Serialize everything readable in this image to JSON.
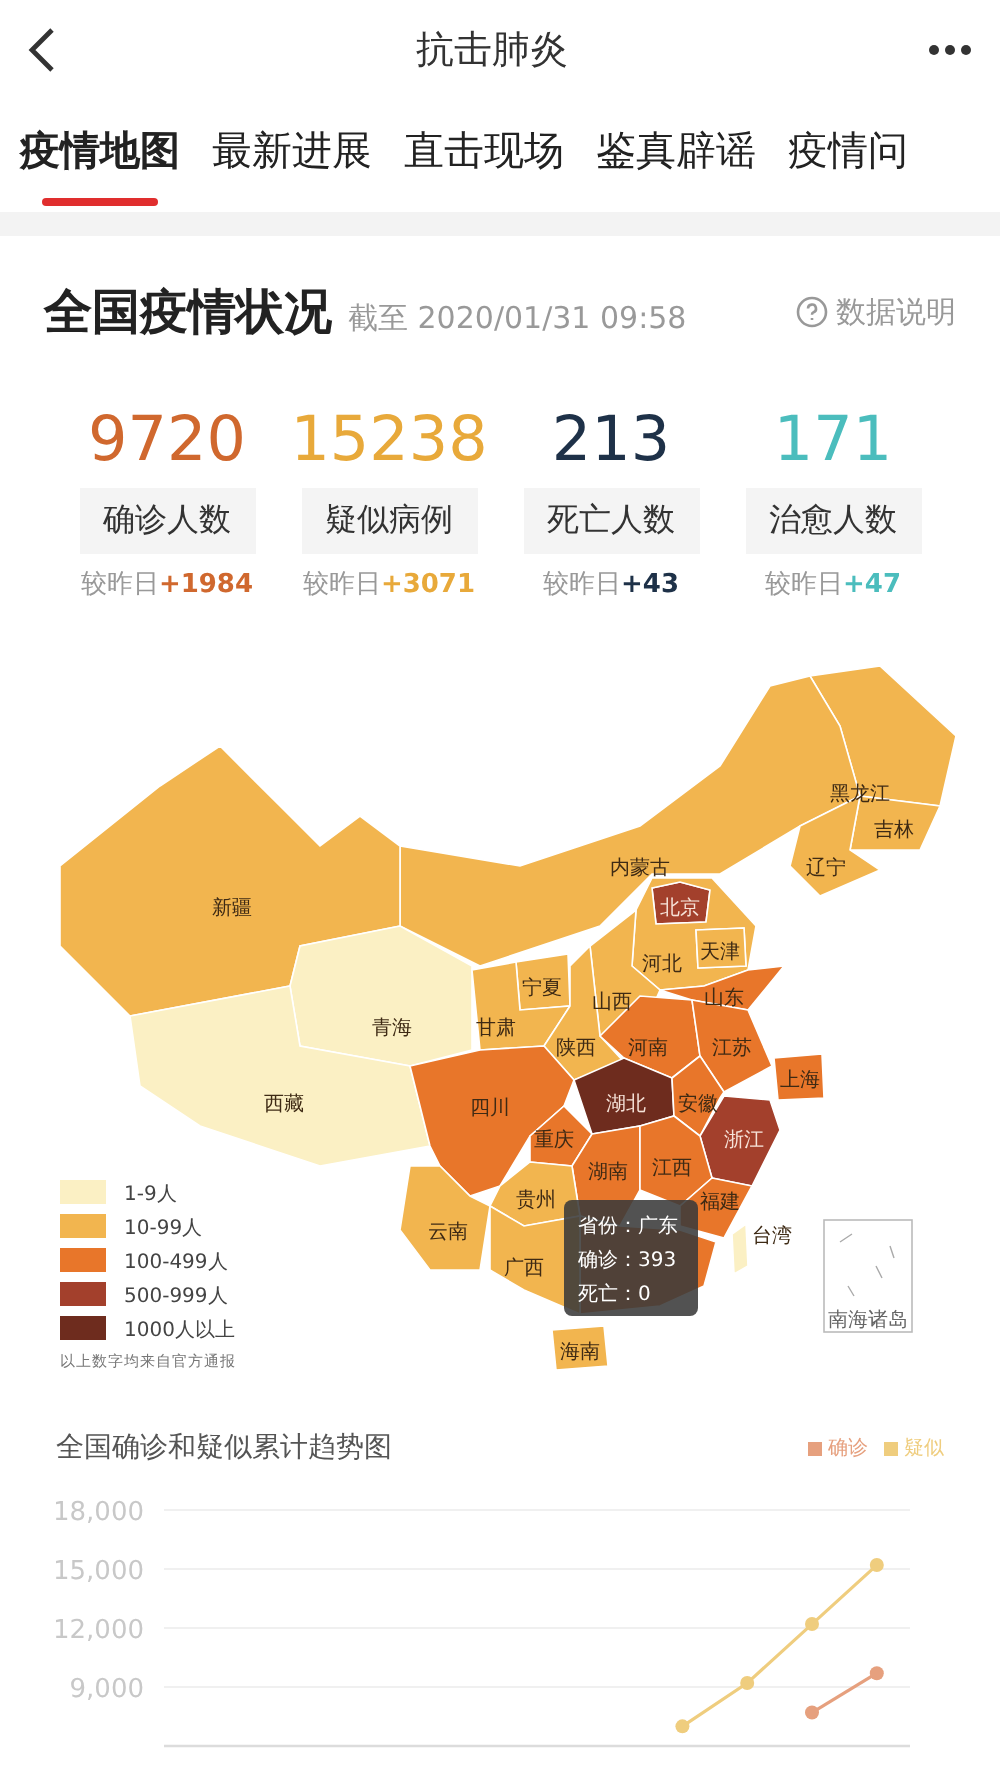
{
  "header": {
    "title": "抗击肺炎"
  },
  "tabs": [
    {
      "label": "疫情地图",
      "selected": true
    },
    {
      "label": "最新进展",
      "selected": false
    },
    {
      "label": "直击现场",
      "selected": false
    },
    {
      "label": "鉴真辟谣",
      "selected": false
    },
    {
      "label": "疫情问",
      "selected": false
    }
  ],
  "summary": {
    "title": "全国疫情状况",
    "timestamp": "截至 2020/01/31 09:58",
    "help": "数据说明",
    "stats": [
      {
        "value": "9720",
        "label": "确诊人数",
        "delta_prefix": "较昨日",
        "delta": "+1984",
        "color": "#d0682e"
      },
      {
        "value": "15238",
        "label": "疑似病例",
        "delta_prefix": "较昨日",
        "delta": "+3071",
        "color": "#e8a93a"
      },
      {
        "value": "213",
        "label": "死亡人数",
        "delta_prefix": "较昨日",
        "delta": "+43",
        "color": "#1e3148"
      },
      {
        "value": "171",
        "label": "治愈人数",
        "delta_prefix": "较昨日",
        "delta": "+47",
        "color": "#4bbdbd"
      }
    ]
  },
  "map": {
    "provinces": [
      {
        "name": "黑龙江",
        "color": "#f2b54f"
      },
      {
        "name": "吉林",
        "color": "#f2b54f"
      },
      {
        "name": "内蒙古",
        "color": "#f2b54f"
      },
      {
        "name": "辽宁",
        "color": "#f2b54f"
      },
      {
        "name": "新疆",
        "color": "#f2b54f"
      },
      {
        "name": "北京",
        "color": "#a3402c"
      },
      {
        "name": "河北",
        "color": "#f2b54f"
      },
      {
        "name": "天津",
        "color": "#f2b54f"
      },
      {
        "name": "宁夏",
        "color": "#f2b54f"
      },
      {
        "name": "山西",
        "color": "#f2b54f"
      },
      {
        "name": "山东",
        "color": "#e8762a"
      },
      {
        "name": "青海",
        "color": "#fbf0c4"
      },
      {
        "name": "甘肃",
        "color": "#f2b54f"
      },
      {
        "name": "陕西",
        "color": "#f2b54f"
      },
      {
        "name": "河南",
        "color": "#e8762a"
      },
      {
        "name": "江苏",
        "color": "#e8762a"
      },
      {
        "name": "上海",
        "color": "#e8762a"
      },
      {
        "name": "西藏",
        "color": "#fbf0c4"
      },
      {
        "name": "四川",
        "color": "#e8762a"
      },
      {
        "name": "湖北",
        "color": "#6e2c1e"
      },
      {
        "name": "安徽",
        "color": "#e8762a"
      },
      {
        "name": "重庆",
        "color": "#e8762a"
      },
      {
        "name": "浙江",
        "color": "#a3402c"
      },
      {
        "name": "湖南",
        "color": "#e8762a"
      },
      {
        "name": "江西",
        "color": "#e8762a"
      },
      {
        "name": "贵州",
        "color": "#f2b54f"
      },
      {
        "name": "福建",
        "color": "#e8762a"
      },
      {
        "name": "云南",
        "color": "#f2b54f"
      },
      {
        "name": "台湾",
        "color": "#fbf0c4"
      },
      {
        "color": "#e8762a"
      },
      {
        "name": "广西",
        "color": "#f2b54f"
      },
      {
        "name": "海南",
        "color": "#f2b54f"
      }
    ],
    "inset_label": "南海诸岛",
    "legend": [
      {
        "label": "1-9人",
        "color": "#fbf0c4"
      },
      {
        "label": "10-99人",
        "color": "#f2b54f"
      },
      {
        "label": "100-499人",
        "color": "#e8762a"
      },
      {
        "label": "500-999人",
        "color": "#a3402c"
      },
      {
        "label": "1000人以上",
        "color": "#6e2c1e"
      }
    ],
    "footnote": "以上数字均来自官方通报",
    "tooltip": [
      "省份：广东",
      "确诊：393",
      "死亡：0"
    ]
  },
  "trend": {
    "title": "全国确诊和疑似累计趋势图",
    "chart_data": {
      "type": "line",
      "grid": true,
      "ylim": [
        6000,
        18000
      ],
      "yticks": [
        {
          "value": 9000,
          "label": "9,000"
        },
        {
          "value": 12000,
          "label": "12,000"
        },
        {
          "value": 15000,
          "label": "15,000"
        },
        {
          "value": 18000,
          "label": "18,000"
        }
      ],
      "series": [
        {
          "name": "确诊",
          "color": "#e6a07e",
          "marker": "circle",
          "values": [
            null,
            null,
            null,
            null,
            null,
            null,
            null,
            null,
            null,
            null,
            7700,
            9700
          ]
        },
        {
          "name": "疑似",
          "color": "#efcd7e",
          "marker": "circle",
          "values": [
            null,
            null,
            null,
            null,
            null,
            null,
            null,
            null,
            7000,
            9200,
            12200,
            15200
          ]
        }
      ]
    }
  }
}
